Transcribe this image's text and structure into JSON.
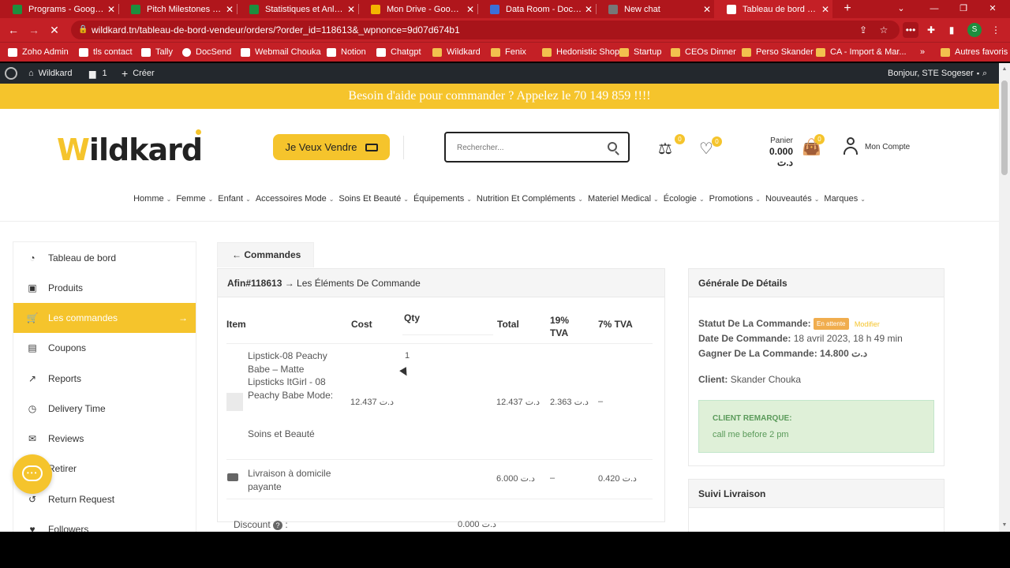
{
  "browser": {
    "tabs": [
      {
        "title": "Programs - Google Sh",
        "icon": "sheets-icon",
        "color": "#1e8e3e"
      },
      {
        "title": "Pitch Milestones - Go",
        "icon": "sheets-icon",
        "color": "#1e8e3e"
      },
      {
        "title": "Statistiques et Anlyse",
        "icon": "sheets-icon",
        "color": "#1e8e3e"
      },
      {
        "title": "Mon Drive - Google D",
        "icon": "drive-icon",
        "color": "#f4b400"
      },
      {
        "title": "Data Room - DocSend",
        "icon": "docsend-icon",
        "color": "#3b6fd8"
      },
      {
        "title": "New chat",
        "icon": "chat-icon",
        "color": "#777777"
      },
      {
        "title": "Tableau de bord Vende",
        "icon": "loading-icon",
        "color": "#ffffff"
      }
    ],
    "tab_close": "✕",
    "new_tab": "+",
    "url": "wildkard.tn/tableau-de-bord-vendeur/orders/?order_id=118613&_wpnonce=9d07d674b1",
    "profile_initial": "S",
    "bookmarks": [
      {
        "label": "Zoho Admin",
        "type": "gen"
      },
      {
        "label": "tls contact",
        "type": "gen"
      },
      {
        "label": "Tally",
        "type": "gen"
      },
      {
        "label": "DocSend",
        "type": "app"
      },
      {
        "label": "Webmail Chouka",
        "type": "gen"
      },
      {
        "label": "Notion",
        "type": "gen"
      },
      {
        "label": "Chatgpt",
        "type": "gen"
      },
      {
        "label": "Wildkard",
        "type": "folder"
      },
      {
        "label": "Fenix",
        "type": "folder"
      },
      {
        "label": "Hedonistic Shop",
        "type": "folder"
      },
      {
        "label": "Startup",
        "type": "folder"
      },
      {
        "label": "CEOs Dinner",
        "type": "folder"
      },
      {
        "label": "Perso Skander",
        "type": "folder"
      },
      {
        "label": "CA - Import & Mar...",
        "type": "folder"
      }
    ],
    "more_bookmarks": "»",
    "other_bookmarks": "Autres favoris"
  },
  "wp_admin": {
    "site_name": "Wildkard",
    "comments_count": "1",
    "create_label": "Créer",
    "greeting": "Bonjour, STE Sogeser"
  },
  "site": {
    "banner": "Besoin d'aide pour commander ? Appelez le 70 149 859 !!!!",
    "logo_text": "ildkard",
    "logo_letter": "W",
    "sell_button": "Je Veux Vendre",
    "search_placeholder": "Rechercher...",
    "compare_count": "0",
    "wishlist_count": "0",
    "cart_count": "0",
    "cart_label": "Panier",
    "cart_total": "0.000 د.ت",
    "account_label": "Mon Compte",
    "menu": [
      "Homme",
      "Femme",
      "Enfant",
      "Accessoires Mode",
      "Soins Et Beauté",
      "Équipements",
      "Nutrition Et Compléments",
      "Materiel Medical",
      "Écologie",
      "Promotions",
      "Nouveautés",
      "Marques"
    ]
  },
  "sidebar": {
    "items": [
      {
        "label": "Tableau de bord",
        "icon": "dashboard-icon",
        "glyph": "◔"
      },
      {
        "label": "Produits",
        "icon": "briefcase-icon",
        "glyph": "▣"
      },
      {
        "label": "Les commandes",
        "icon": "cart-icon",
        "glyph": "🛒"
      },
      {
        "label": "Coupons",
        "icon": "gift-icon",
        "glyph": "▤"
      },
      {
        "label": "Reports",
        "icon": "chart-icon",
        "glyph": "↗"
      },
      {
        "label": "Delivery Time",
        "icon": "clock-icon",
        "glyph": "◷"
      },
      {
        "label": "Reviews",
        "icon": "comments-icon",
        "glyph": "✉"
      },
      {
        "label": "Retirer",
        "icon": "upload-icon",
        "glyph": "⇧"
      },
      {
        "label": "Return Request",
        "icon": "undo-icon",
        "glyph": "↺"
      },
      {
        "label": "Followers",
        "icon": "heart-icon",
        "glyph": "♥"
      }
    ],
    "active_arrow": "→"
  },
  "order": {
    "back_tab": "← Commandes",
    "panel_title_order": "Afin#118613",
    "panel_title_rest": " → Les Éléments De Commande",
    "columns": {
      "item": "Item",
      "cost": "Cost",
      "qty": "Qty",
      "total": "Total",
      "vat19": "19% TVA",
      "vat7": "7% TVA"
    },
    "product": {
      "name": "Lipstick-08 Peachy Babe – Matte Lipsticks ItGirl - 08 Peachy Babe Mode:",
      "category": "Soins et Beauté",
      "cost": "12.437 د.ت",
      "qty": "1",
      "total": "12.437 د.ت",
      "vat19": "2.363 د.ت",
      "vat7": "–"
    },
    "shipping": {
      "name": "Livraison à domicile payante",
      "total": "6.000 د.ت",
      "vat19": "–",
      "vat7": "0.420 د.ت"
    },
    "discount_label": "Discount",
    "discount_value": "0.000 د.ت"
  },
  "details": {
    "title": "Générale De Détails",
    "status_label": "Statut De La Commande:",
    "status_value": "En attente",
    "modify_label": "Modifier",
    "date_label": "Date De Commande:",
    "date_value": "18 avril 2023, 18 h 49 min",
    "earn_label": "Gagner De La Commande:",
    "earn_value": "14.800 د.ت",
    "client_label": "Client:",
    "client_value": "Skander Chouka",
    "remark_title": "CLIENT REMARQUE:",
    "remark_value": "call me before 2 pm",
    "shipping_title": "Suivi Livraison"
  },
  "colors": {
    "accent": "#f5c42c",
    "chrome": "#c42026",
    "wpbar": "#23282d"
  }
}
